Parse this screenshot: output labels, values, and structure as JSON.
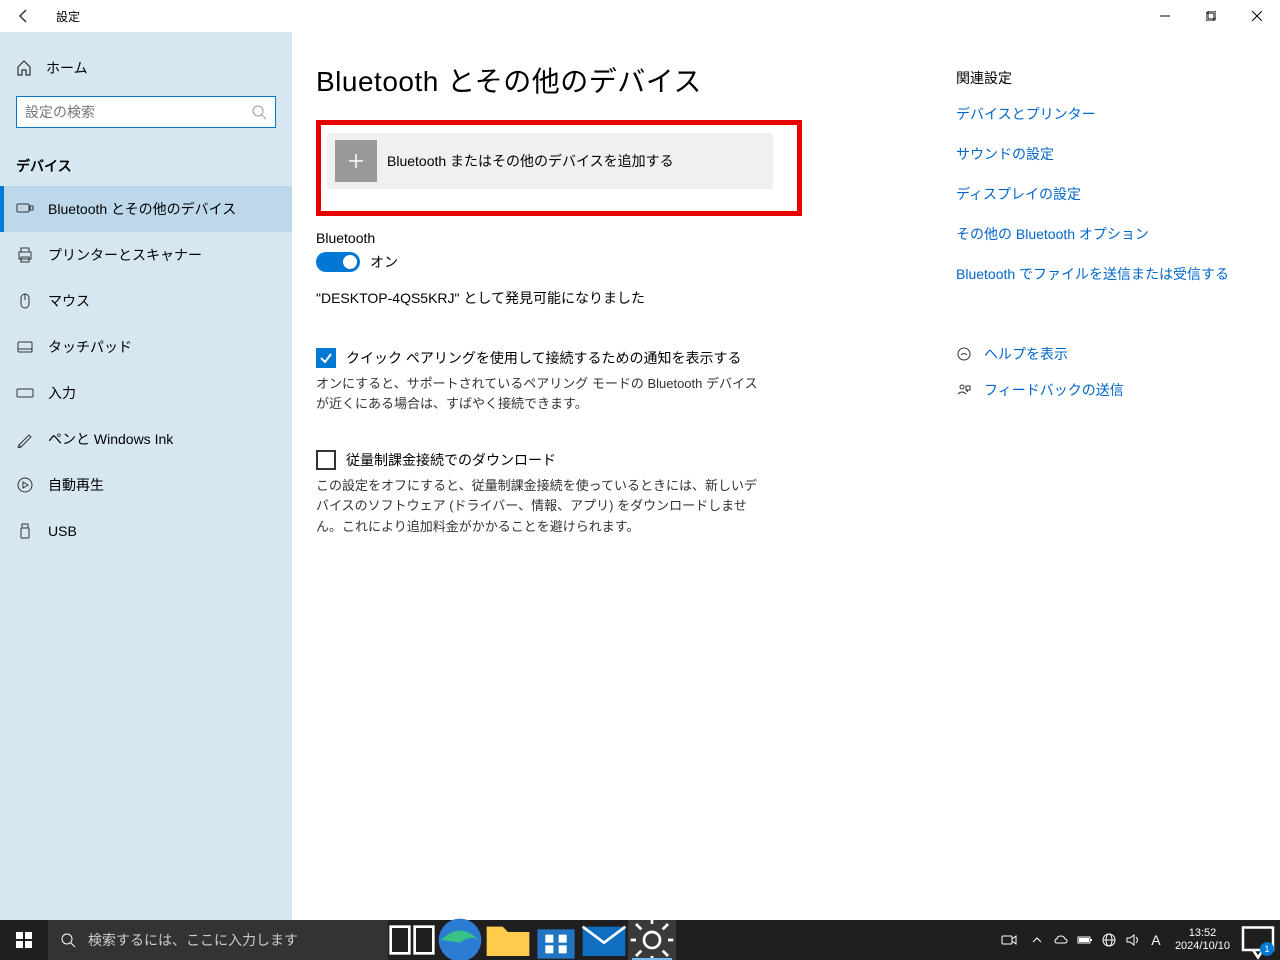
{
  "titlebar": {
    "title": "設定"
  },
  "sidebar": {
    "home": "ホーム",
    "search_placeholder": "設定の検索",
    "heading": "デバイス",
    "items": [
      "Bluetooth とその他のデバイス",
      "プリンターとスキャナー",
      "マウス",
      "タッチパッド",
      "入力",
      "ペンと Windows Ink",
      "自動再生",
      "USB"
    ]
  },
  "content": {
    "page_title": "Bluetooth とその他のデバイス",
    "add_device_label": "Bluetooth またはその他のデバイスを追加する",
    "bluetooth_section": "Bluetooth",
    "toggle_state": "オン",
    "discoverable": "\"DESKTOP-4QS5KRJ\" として発見可能になりました",
    "quick_pair_label": "クイック ペアリングを使用して接続するための通知を表示する",
    "quick_pair_desc": "オンにすると、サポートされているペアリング モードの Bluetooth デバイスが近くにある場合は、すばやく接続できます。",
    "metered_label": "従量制課金接続でのダウンロード",
    "metered_desc": "この設定をオフにすると、従量制課金接続を使っているときには、新しいデバイスのソフトウェア (ドライバー、情報、アプリ) をダウンロードしません。これにより追加料金がかかることを避けられます。"
  },
  "right": {
    "heading": "関連設定",
    "links": [
      "デバイスとプリンター",
      "サウンドの設定",
      "ディスプレイの設定",
      "その他の Bluetooth オプション",
      "Bluetooth でファイルを送信または受信する"
    ],
    "help": "ヘルプを表示",
    "feedback": "フィードバックの送信"
  },
  "taskbar": {
    "search_placeholder": "検索するには、ここに入力します",
    "time": "13:52",
    "date": "2024/10/10",
    "ime": "A",
    "notif_count": "1"
  }
}
